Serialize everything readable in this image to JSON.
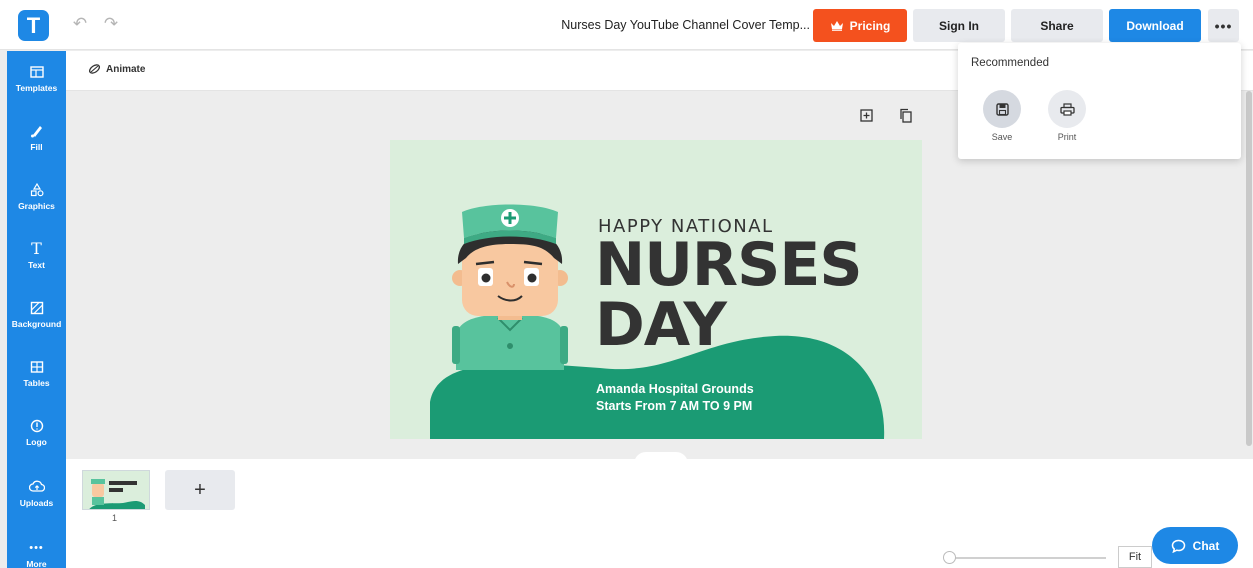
{
  "app": {
    "logo_letter": "T",
    "document_title": "Nurses Day YouTube Channel Cover Temp..."
  },
  "toolbar": {
    "pricing_label": "Pricing",
    "signin_label": "Sign In",
    "share_label": "Share",
    "download_label": "Download",
    "more_label": "•••"
  },
  "sidebar": {
    "items": [
      {
        "label": "Templates",
        "icon": "templates-icon"
      },
      {
        "label": "Fill",
        "icon": "fill-icon"
      },
      {
        "label": "Graphics",
        "icon": "graphics-icon"
      },
      {
        "label": "Text",
        "icon": "text-icon"
      },
      {
        "label": "Background",
        "icon": "background-icon"
      },
      {
        "label": "Tables",
        "icon": "tables-icon"
      },
      {
        "label": "Logo",
        "icon": "logo-icon"
      },
      {
        "label": "Uploads",
        "icon": "uploads-icon"
      },
      {
        "label": "More",
        "icon": "more-icon"
      }
    ]
  },
  "subtoolbar": {
    "animate_label": "Animate"
  },
  "design": {
    "line1": "HAPPY NATIONAL",
    "line2": "NURSES",
    "line3": "DAY",
    "venue": "Amanda Hospital Grounds",
    "time": "Starts From 7 AM TO 9 PM"
  },
  "pages": {
    "current_number": "1",
    "add_label": "+"
  },
  "zoom": {
    "fit_label": "Fit",
    "level": 0.02
  },
  "chat": {
    "label": "Chat"
  },
  "dropdown": {
    "title": "Recommended",
    "save_label": "Save",
    "print_label": "Print"
  },
  "colors": {
    "accent": "#1e88e5",
    "pricing": "#f4511e",
    "design_green": "#1b9b74",
    "design_bg": "#dbeedc"
  }
}
